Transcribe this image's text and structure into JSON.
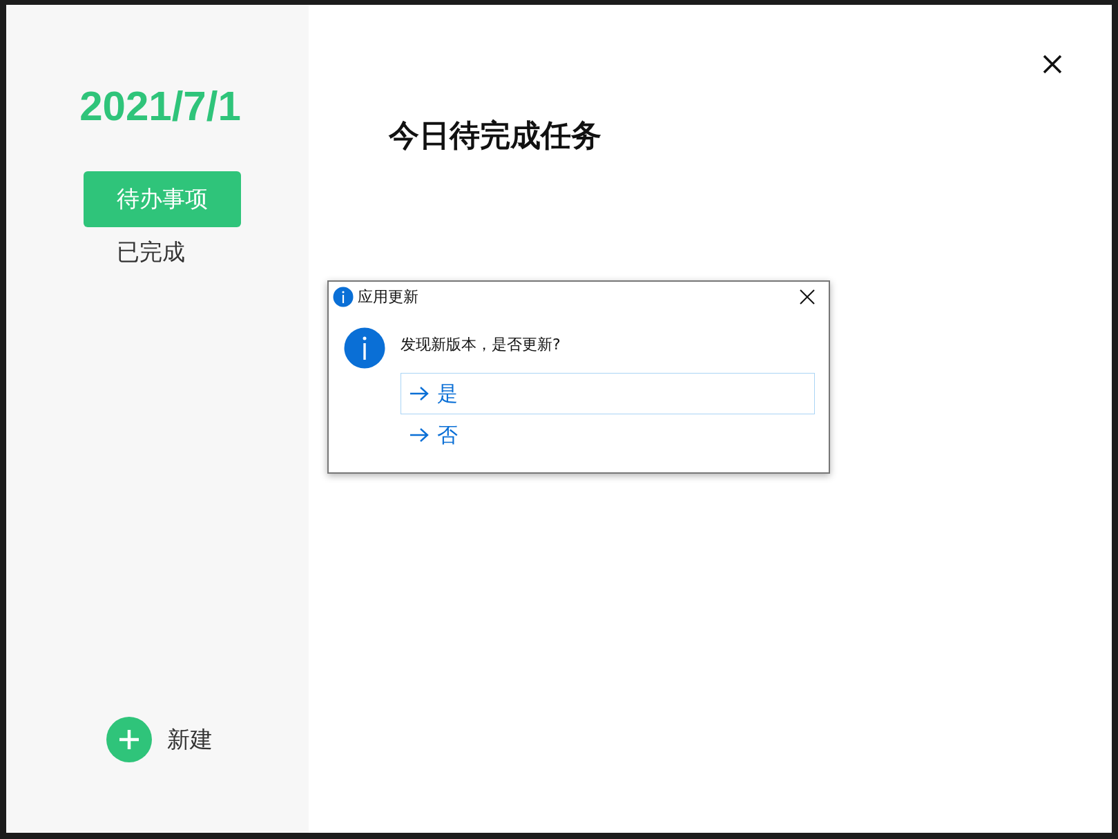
{
  "sidebar": {
    "date": "2021/7/1",
    "nav": [
      {
        "label": "待办事项",
        "selected": true
      },
      {
        "label": "已完成",
        "selected": false
      }
    ],
    "new_button": {
      "label": "新建"
    }
  },
  "main": {
    "title": "今日待完成任务"
  },
  "dialog": {
    "title": "应用更新",
    "message": "发现新版本，是否更新?",
    "options": [
      {
        "label": "是",
        "selected": true
      },
      {
        "label": "否",
        "selected": false
      }
    ]
  }
}
